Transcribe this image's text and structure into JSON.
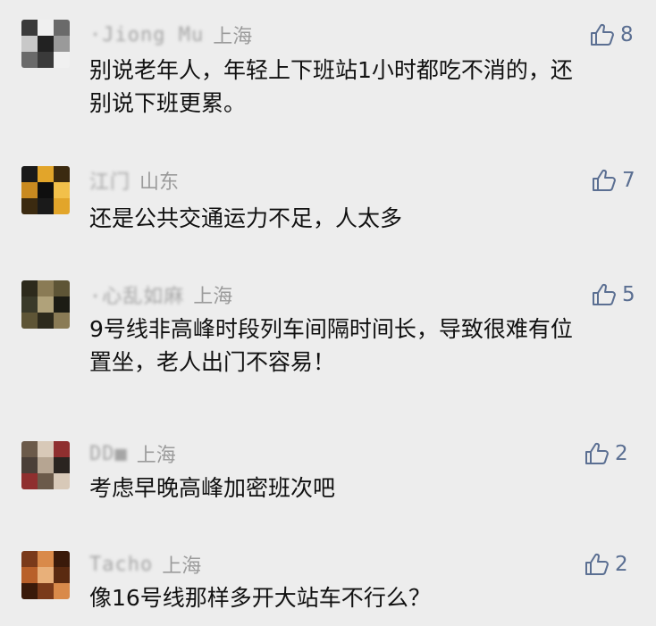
{
  "comments": [
    {
      "nickname": "·Jiong Mu",
      "location": "上海",
      "likes": "8",
      "lines": [
        "别说老年人，年轻上下班站1小时都吃不消的，还",
        "别说下班更累。"
      ],
      "avatar_colors": [
        "#3a3a3a",
        "#f0f0f0",
        "#6a6a6a",
        "#c8c8c8",
        "#222222",
        "#9a9a9a"
      ]
    },
    {
      "nickname": "江门",
      "location": "山东",
      "likes": "7",
      "lines": [
        "还是公共交通运力不足，人太多"
      ],
      "avatar_colors": [
        "#1a1a1a",
        "#e2a52a",
        "#3b2a10",
        "#c98a20",
        "#0f0f0f",
        "#f2c04a"
      ]
    },
    {
      "nickname": "·心乱如麻",
      "location": "上海",
      "likes": "5",
      "lines": [
        "9号线非高峰时段列车间隔时间长，导致很难有位",
        "置坐，老人出门不容易！"
      ],
      "avatar_colors": [
        "#2d2a1c",
        "#8a7b55",
        "#5e5536",
        "#3a3a2a",
        "#b0a27a",
        "#1c1c14"
      ]
    },
    {
      "nickname": "DD■",
      "location": "上海",
      "likes": "2",
      "lines": [
        "考虑早晚高峰加密班次吧"
      ],
      "avatar_colors": [
        "#6b5a4a",
        "#d8c9b8",
        "#8f2f2f",
        "#4a3f38",
        "#b6a592",
        "#2a2420"
      ]
    },
    {
      "nickname": "Tacho",
      "location": "上海",
      "likes": "2",
      "lines": [
        "像16号线那样多开大站车不行么？"
      ],
      "avatar_colors": [
        "#7a3a1a",
        "#d98a4a",
        "#3a1a0a",
        "#b8602a",
        "#e8b07a",
        "#5a2a10"
      ]
    }
  ]
}
